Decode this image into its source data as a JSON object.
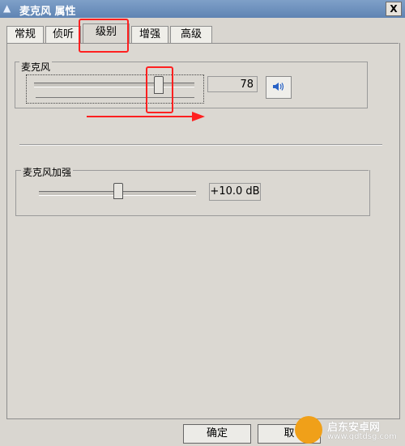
{
  "window": {
    "title": "麦克风 属性",
    "close_glyph": "X"
  },
  "tabs": [
    {
      "label": "常规"
    },
    {
      "label": "侦听"
    },
    {
      "label": "级别"
    },
    {
      "label": "增强"
    },
    {
      "label": "高级"
    }
  ],
  "levels": {
    "mic_group_label": "麦克风",
    "mic_value": "78",
    "mic_level": 78,
    "boost_group_label": "麦克风加强",
    "boost_value": "+10.0 dB"
  },
  "buttons": {
    "ok_label": "确定",
    "cancel_label": "取"
  },
  "watermark": {
    "brand": "启东安卓网",
    "url": "www.qdtdsg.com"
  },
  "colors": {
    "annotation": "#ff2020",
    "titlebar": "#5f84b3"
  },
  "icons": [
    "app-icon",
    "close-icon",
    "speaker-icon",
    "annotation-arrow-icon"
  ]
}
